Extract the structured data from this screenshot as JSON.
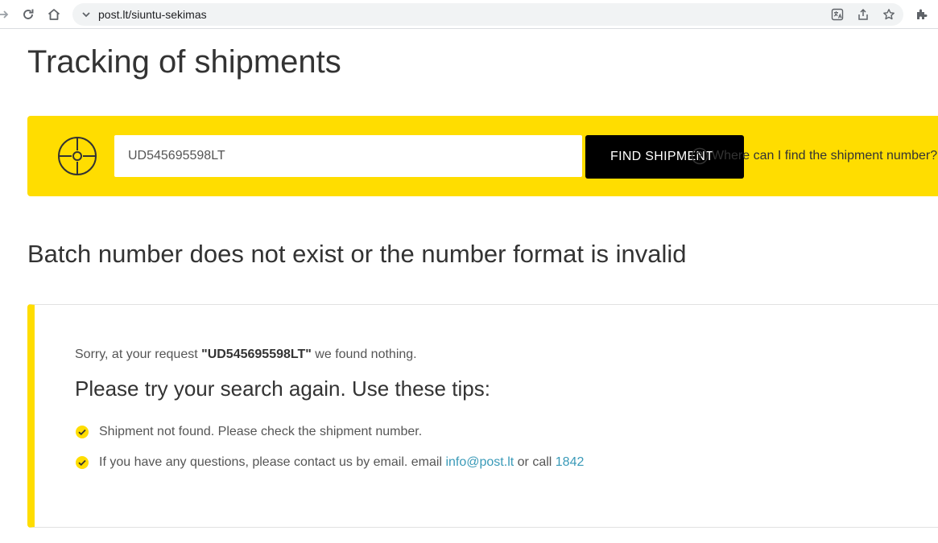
{
  "browser": {
    "url": "post.lt/siuntu-sekimas",
    "icons": [
      "forward-icon",
      "reload-icon",
      "home-icon",
      "tab-search-icon",
      "translate-icon",
      "share-icon",
      "bookmark-star-icon",
      "extensions-icon"
    ]
  },
  "page": {
    "title": "Tracking of shipments"
  },
  "search": {
    "value": "UD545695598LT",
    "button_label": "FIND SHIPMENT",
    "help_text": "Where can I find the shipment number?"
  },
  "result": {
    "heading": "Batch number does not exist or the number format is invalid",
    "sorry_prefix": "Sorry, at your request ",
    "query": "\"UD545695598LT\"",
    "sorry_suffix": " we found nothing.",
    "tips_title": "Please try your search again. Use these tips:",
    "tip1": "Shipment not found. Please check the shipment number.",
    "tip2_prefix": "If you have any questions, please contact us by email. email ",
    "email": "info@post.lt",
    "tip2_middle": " or call ",
    "phone": "1842"
  },
  "colors": {
    "brand_yellow": "#ffdd00",
    "button_black": "#000000",
    "link_blue": "#3a9ab8"
  }
}
